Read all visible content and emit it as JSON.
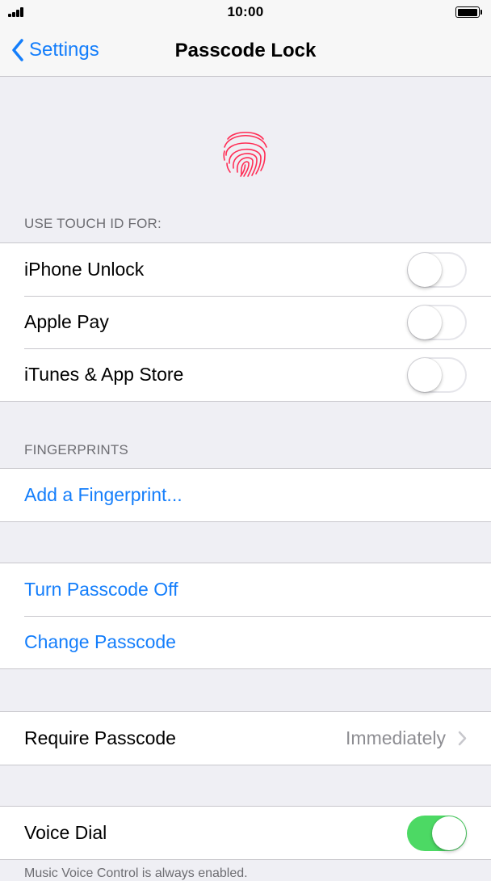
{
  "status": {
    "time": "10:00"
  },
  "nav": {
    "back_label": "Settings",
    "title": "Passcode Lock"
  },
  "touch_id": {
    "icon": "fingerprint-icon",
    "color": "#ff2d55",
    "header": "USE TOUCH ID FOR:",
    "items": [
      {
        "label": "iPhone Unlock",
        "on": false
      },
      {
        "label": "Apple Pay",
        "on": false
      },
      {
        "label": "iTunes & App Store",
        "on": false
      }
    ]
  },
  "fingerprints": {
    "header": "FINGERPRINTS",
    "add_label": "Add a Fingerprint..."
  },
  "passcode": {
    "turn_off_label": "Turn Passcode Off",
    "change_label": "Change Passcode"
  },
  "require": {
    "label": "Require Passcode",
    "value": "Immediately"
  },
  "voice_dial": {
    "label": "Voice Dial",
    "on": true
  },
  "footer_text": "Music Voice Control is always enabled.",
  "colors": {
    "accent": "#147efb",
    "toggle_on": "#4cd964",
    "background": "#efeff4"
  }
}
